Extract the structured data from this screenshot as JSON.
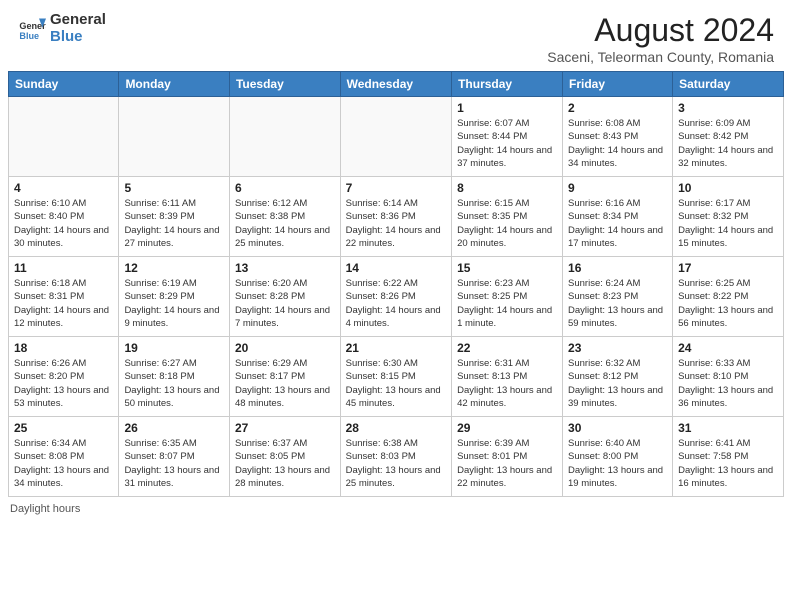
{
  "header": {
    "logo_general": "General",
    "logo_blue": "Blue",
    "month_year": "August 2024",
    "location": "Saceni, Teleorman County, Romania"
  },
  "days_of_week": [
    "Sunday",
    "Monday",
    "Tuesday",
    "Wednesday",
    "Thursday",
    "Friday",
    "Saturday"
  ],
  "weeks": [
    [
      {
        "day": "",
        "info": ""
      },
      {
        "day": "",
        "info": ""
      },
      {
        "day": "",
        "info": ""
      },
      {
        "day": "",
        "info": ""
      },
      {
        "day": "1",
        "info": "Sunrise: 6:07 AM\nSunset: 8:44 PM\nDaylight: 14 hours and 37 minutes."
      },
      {
        "day": "2",
        "info": "Sunrise: 6:08 AM\nSunset: 8:43 PM\nDaylight: 14 hours and 34 minutes."
      },
      {
        "day": "3",
        "info": "Sunrise: 6:09 AM\nSunset: 8:42 PM\nDaylight: 14 hours and 32 minutes."
      }
    ],
    [
      {
        "day": "4",
        "info": "Sunrise: 6:10 AM\nSunset: 8:40 PM\nDaylight: 14 hours and 30 minutes."
      },
      {
        "day": "5",
        "info": "Sunrise: 6:11 AM\nSunset: 8:39 PM\nDaylight: 14 hours and 27 minutes."
      },
      {
        "day": "6",
        "info": "Sunrise: 6:12 AM\nSunset: 8:38 PM\nDaylight: 14 hours and 25 minutes."
      },
      {
        "day": "7",
        "info": "Sunrise: 6:14 AM\nSunset: 8:36 PM\nDaylight: 14 hours and 22 minutes."
      },
      {
        "day": "8",
        "info": "Sunrise: 6:15 AM\nSunset: 8:35 PM\nDaylight: 14 hours and 20 minutes."
      },
      {
        "day": "9",
        "info": "Sunrise: 6:16 AM\nSunset: 8:34 PM\nDaylight: 14 hours and 17 minutes."
      },
      {
        "day": "10",
        "info": "Sunrise: 6:17 AM\nSunset: 8:32 PM\nDaylight: 14 hours and 15 minutes."
      }
    ],
    [
      {
        "day": "11",
        "info": "Sunrise: 6:18 AM\nSunset: 8:31 PM\nDaylight: 14 hours and 12 minutes."
      },
      {
        "day": "12",
        "info": "Sunrise: 6:19 AM\nSunset: 8:29 PM\nDaylight: 14 hours and 9 minutes."
      },
      {
        "day": "13",
        "info": "Sunrise: 6:20 AM\nSunset: 8:28 PM\nDaylight: 14 hours and 7 minutes."
      },
      {
        "day": "14",
        "info": "Sunrise: 6:22 AM\nSunset: 8:26 PM\nDaylight: 14 hours and 4 minutes."
      },
      {
        "day": "15",
        "info": "Sunrise: 6:23 AM\nSunset: 8:25 PM\nDaylight: 14 hours and 1 minute."
      },
      {
        "day": "16",
        "info": "Sunrise: 6:24 AM\nSunset: 8:23 PM\nDaylight: 13 hours and 59 minutes."
      },
      {
        "day": "17",
        "info": "Sunrise: 6:25 AM\nSunset: 8:22 PM\nDaylight: 13 hours and 56 minutes."
      }
    ],
    [
      {
        "day": "18",
        "info": "Sunrise: 6:26 AM\nSunset: 8:20 PM\nDaylight: 13 hours and 53 minutes."
      },
      {
        "day": "19",
        "info": "Sunrise: 6:27 AM\nSunset: 8:18 PM\nDaylight: 13 hours and 50 minutes."
      },
      {
        "day": "20",
        "info": "Sunrise: 6:29 AM\nSunset: 8:17 PM\nDaylight: 13 hours and 48 minutes."
      },
      {
        "day": "21",
        "info": "Sunrise: 6:30 AM\nSunset: 8:15 PM\nDaylight: 13 hours and 45 minutes."
      },
      {
        "day": "22",
        "info": "Sunrise: 6:31 AM\nSunset: 8:13 PM\nDaylight: 13 hours and 42 minutes."
      },
      {
        "day": "23",
        "info": "Sunrise: 6:32 AM\nSunset: 8:12 PM\nDaylight: 13 hours and 39 minutes."
      },
      {
        "day": "24",
        "info": "Sunrise: 6:33 AM\nSunset: 8:10 PM\nDaylight: 13 hours and 36 minutes."
      }
    ],
    [
      {
        "day": "25",
        "info": "Sunrise: 6:34 AM\nSunset: 8:08 PM\nDaylight: 13 hours and 34 minutes."
      },
      {
        "day": "26",
        "info": "Sunrise: 6:35 AM\nSunset: 8:07 PM\nDaylight: 13 hours and 31 minutes."
      },
      {
        "day": "27",
        "info": "Sunrise: 6:37 AM\nSunset: 8:05 PM\nDaylight: 13 hours and 28 minutes."
      },
      {
        "day": "28",
        "info": "Sunrise: 6:38 AM\nSunset: 8:03 PM\nDaylight: 13 hours and 25 minutes."
      },
      {
        "day": "29",
        "info": "Sunrise: 6:39 AM\nSunset: 8:01 PM\nDaylight: 13 hours and 22 minutes."
      },
      {
        "day": "30",
        "info": "Sunrise: 6:40 AM\nSunset: 8:00 PM\nDaylight: 13 hours and 19 minutes."
      },
      {
        "day": "31",
        "info": "Sunrise: 6:41 AM\nSunset: 7:58 PM\nDaylight: 13 hours and 16 minutes."
      }
    ]
  ],
  "footer": {
    "daylight_label": "Daylight hours"
  }
}
